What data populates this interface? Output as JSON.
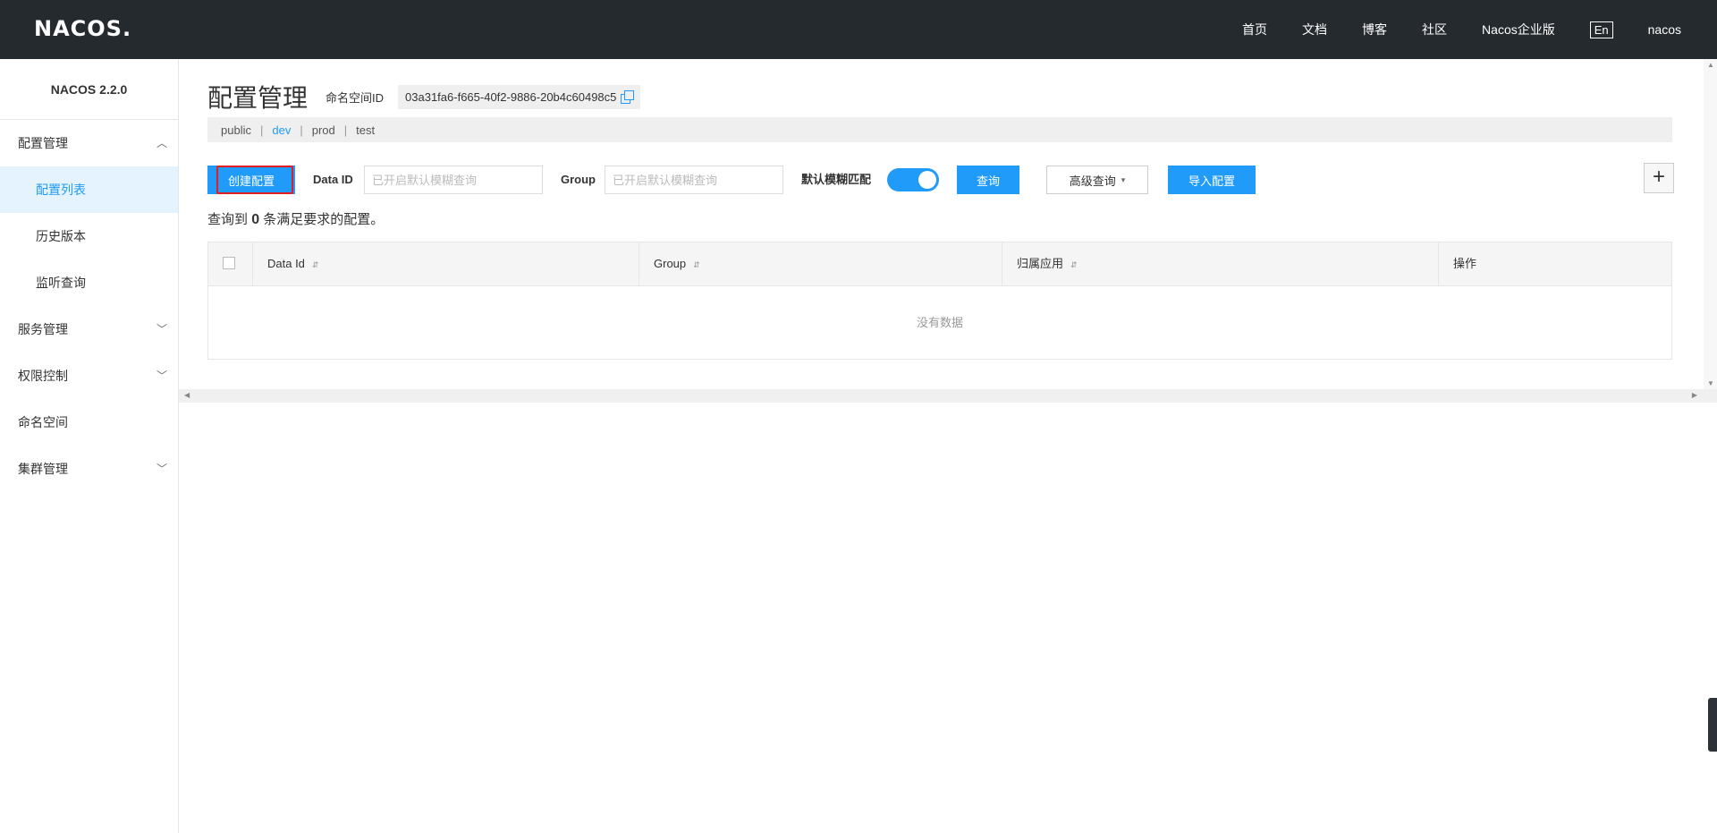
{
  "topbar": {
    "logo": "NACOS.",
    "nav": [
      "首页",
      "文档",
      "博客",
      "社区",
      "Nacos企业版"
    ],
    "lang": "En",
    "user": "nacos"
  },
  "sidebar": {
    "version": "NACOS 2.2.0",
    "items": [
      {
        "label": "配置管理",
        "expandable": true
      },
      {
        "label": "配置列表",
        "sub": true,
        "active": true
      },
      {
        "label": "历史版本",
        "sub": true
      },
      {
        "label": "监听查询",
        "sub": true
      },
      {
        "label": "服务管理",
        "expandable": true
      },
      {
        "label": "权限控制",
        "expandable": true
      },
      {
        "label": "命名空间",
        "expandable": false
      },
      {
        "label": "集群管理",
        "expandable": true
      }
    ]
  },
  "main": {
    "title": "配置管理",
    "ns_label": "命名空间ID",
    "ns_id": "03a31fa6-f665-40f2-9886-20b4c60498c5",
    "namespaces": [
      "public",
      "dev",
      "prod",
      "test"
    ],
    "active_namespace": "dev",
    "toolbar": {
      "create_label": "创建配置",
      "dataid_label": "Data ID",
      "dataid_placeholder": "已开启默认模糊查询",
      "group_label": "Group",
      "group_placeholder": "已开启默认模糊查询",
      "fuzzy_label": "默认模糊匹配",
      "fuzzy_on": true,
      "search_label": "查询",
      "advanced_label": "高级查询",
      "import_label": "导入配置",
      "plus_label": "+"
    },
    "result": {
      "prefix": "查询到",
      "count": "0",
      "suffix": "条满足要求的配置。"
    },
    "table": {
      "columns": [
        "Data Id",
        "Group",
        "归属应用",
        "操作"
      ],
      "empty": "没有数据"
    }
  },
  "colors": {
    "accent": "#209bfa",
    "topbar": "#252a2f",
    "highlight": "#e02020"
  }
}
